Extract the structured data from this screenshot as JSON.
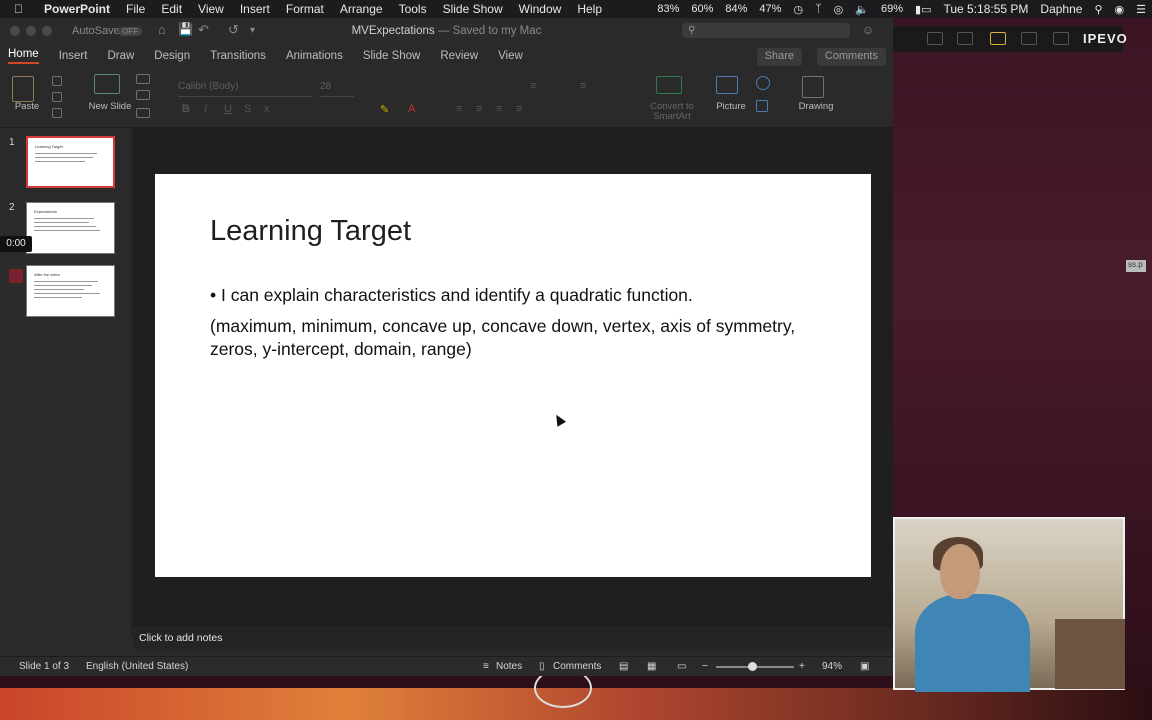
{
  "menubar": {
    "app": "PowerPoint",
    "items": [
      "File",
      "Edit",
      "View",
      "Insert",
      "Format",
      "Arrange",
      "Tools",
      "Slide Show",
      "Window",
      "Help"
    ],
    "status": [
      "83%",
      "60%",
      "84%",
      "47%"
    ],
    "battery": "69%",
    "clock": "Tue 5:18:55 PM",
    "user": "Daphne"
  },
  "titlebar": {
    "autosave": "AutoSave",
    "autosave_state": "OFF",
    "doc_name": "MVExpectations",
    "saved": "— Saved to my Mac"
  },
  "ribbon_tabs": [
    "Home",
    "Insert",
    "Draw",
    "Design",
    "Transitions",
    "Animations",
    "Slide Show",
    "Review",
    "View"
  ],
  "share_label": "Share",
  "comments_label": "Comments",
  "ribbon": {
    "paste": "Paste",
    "new_slide": "New Slide",
    "font": "Calibri (Body)",
    "size": "28",
    "convert": "Convert to SmartArt",
    "picture": "Picture",
    "drawing": "Drawing"
  },
  "thumbnails": [
    {
      "num": "1",
      "title": "Learning Target"
    },
    {
      "num": "2",
      "title": "Expectations"
    },
    {
      "num": "3",
      "title": "After the video"
    }
  ],
  "timer": "0:00",
  "slide": {
    "title": "Learning Target",
    "bullet": "• I can explain characteristics and identify a quadratic function.",
    "detail": "(maximum, minimum, concave up, concave down, vertex, axis of symmetry, zeros, y-intercept, domain, range)"
  },
  "notes_placeholder": "Click to add notes",
  "statusbar": {
    "slide_count": "Slide 1 of 3",
    "language": "English (United States)",
    "notes": "Notes",
    "comments": "Comments",
    "zoom": "94%"
  },
  "ipevo_logo": "IPEVO",
  "side_tag": "ss.p"
}
